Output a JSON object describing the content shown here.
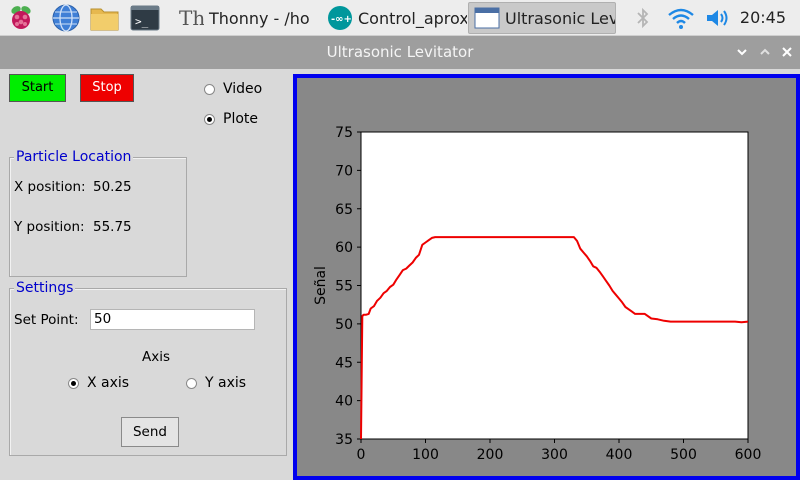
{
  "taskbar": {
    "tasks": [
      {
        "label": "Thonny  -  /ho"
      },
      {
        "label": "Control_aprox"
      },
      {
        "label": "Ultrasonic Lev"
      }
    ],
    "clock": "20:45"
  },
  "window": {
    "title": "Ultrasonic Levitator"
  },
  "controls": {
    "start_label": "Start",
    "stop_label": "Stop",
    "mode_options": [
      {
        "label": "Video",
        "selected": false
      },
      {
        "label": "Plote",
        "selected": true
      }
    ]
  },
  "particle_location": {
    "title": "Particle Location",
    "x_label": "X position:",
    "x_value": "50.25",
    "y_label": "Y position:",
    "y_value": "55.75"
  },
  "settings": {
    "title": "Settings",
    "setpoint_label": "Set Point:",
    "setpoint_value": "50",
    "axis_label": "Axis",
    "axis_options": [
      {
        "label": "X axis",
        "selected": true
      },
      {
        "label": "Y axis",
        "selected": false
      }
    ],
    "send_label": "Send"
  },
  "chart_data": {
    "type": "line",
    "ylabel": "Señal",
    "xlim": [
      0,
      600
    ],
    "ylim": [
      35,
      75
    ],
    "xticks": [
      0,
      100,
      200,
      300,
      400,
      500,
      600
    ],
    "yticks": [
      35,
      40,
      45,
      50,
      55,
      60,
      65,
      70,
      75
    ],
    "grid": false,
    "series": [
      {
        "color": "#ee0000",
        "x": [
          0,
          2,
          4,
          8,
          12,
          15,
          20,
          25,
          30,
          35,
          40,
          45,
          50,
          55,
          60,
          65,
          70,
          75,
          80,
          85,
          90,
          95,
          100,
          105,
          110,
          115,
          120,
          130,
          150,
          200,
          250,
          300,
          330,
          335,
          340,
          345,
          350,
          355,
          360,
          365,
          370,
          375,
          380,
          385,
          390,
          395,
          400,
          405,
          410,
          415,
          420,
          425,
          430,
          440,
          450,
          460,
          470,
          480,
          490,
          500,
          550,
          580,
          590,
          600
        ],
        "y": [
          35,
          51,
          51.2,
          51.2,
          51.3,
          52,
          52.3,
          53,
          53.4,
          54,
          54.3,
          54.8,
          55.1,
          55.8,
          56.4,
          57,
          57.2,
          57.6,
          58,
          58.6,
          59,
          60.3,
          60.6,
          60.9,
          61.2,
          61.3,
          61.3,
          61.3,
          61.3,
          61.3,
          61.3,
          61.3,
          61.3,
          60.8,
          59.8,
          59.3,
          58.8,
          58.2,
          57.5,
          57.3,
          56.8,
          56.2,
          55.6,
          55,
          54.3,
          53.8,
          53.3,
          52.8,
          52.2,
          51.9,
          51.6,
          51.3,
          51.3,
          51.3,
          50.7,
          50.6,
          50.4,
          50.3,
          50.3,
          50.3,
          50.3,
          50.3,
          50.2,
          50.3
        ]
      }
    ]
  }
}
